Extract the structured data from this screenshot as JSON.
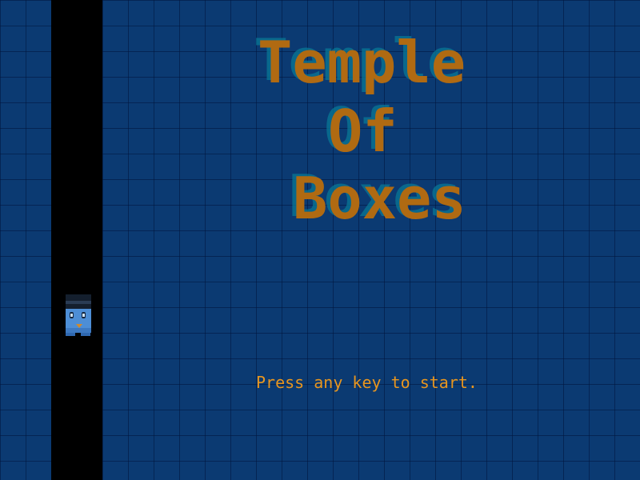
{
  "game": {
    "title_lines": [
      "Temple",
      "Of",
      "Boxes"
    ],
    "start_prompt": "Press any key to start."
  },
  "colors": {
    "background": "#0b3a72",
    "grid_line": "#062a55",
    "title_text": "#b06a12",
    "title_shadow": "#0a7896",
    "prompt_text": "#e8961f",
    "column": "#000000"
  },
  "icons": {
    "player": "box-character-sprite"
  }
}
